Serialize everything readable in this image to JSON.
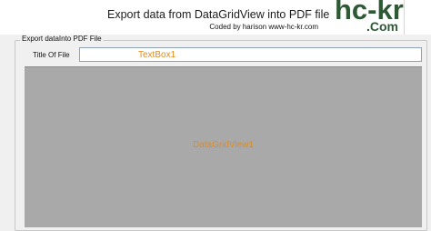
{
  "header": {
    "title": "Export data from DataGridView into PDF file",
    "subtitle": "Coded by harison www-hc-kr.com"
  },
  "logo": {
    "main": "hc-kr",
    "sub": ".Com"
  },
  "group": {
    "legend": "Export dataInto PDF File"
  },
  "form": {
    "title_label": "Title Of File",
    "title_value": "TextBox1"
  },
  "grid": {
    "name": "DataGridView1"
  }
}
